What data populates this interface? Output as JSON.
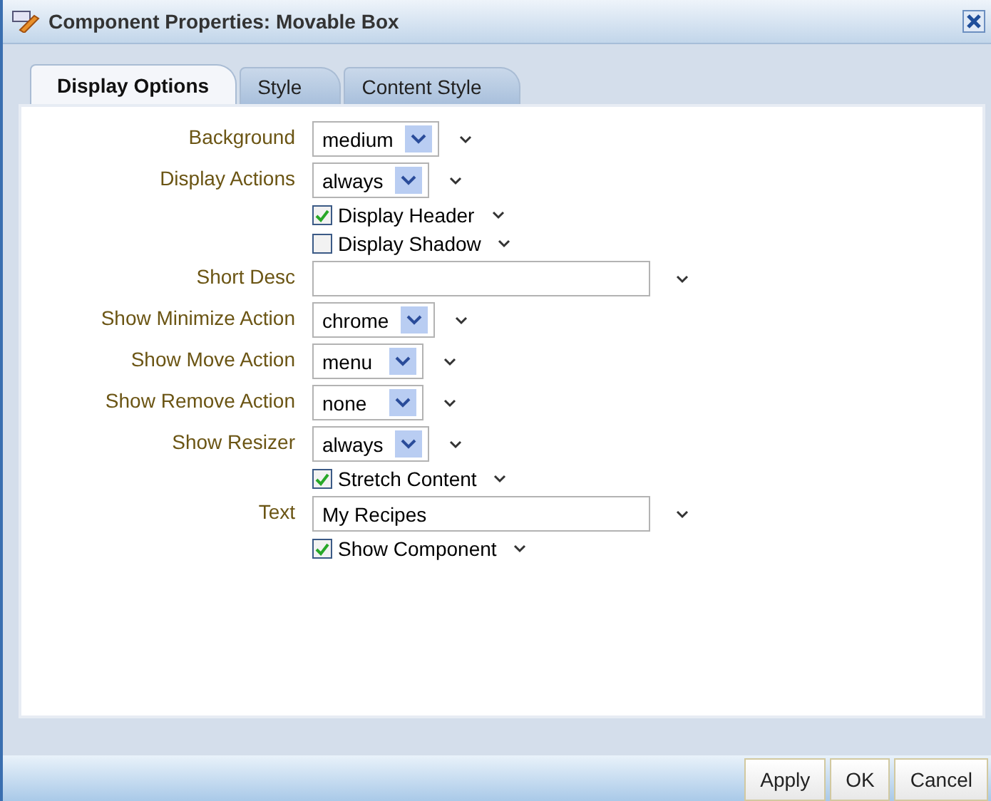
{
  "window": {
    "title": "Component Properties: Movable Box"
  },
  "tabs": [
    {
      "label": "Display Options",
      "selected": true
    },
    {
      "label": "Style",
      "selected": false
    },
    {
      "label": "Content Style",
      "selected": false
    }
  ],
  "fields": [
    {
      "kind": "select",
      "label": "Background",
      "value": "medium"
    },
    {
      "kind": "select",
      "label": "Display Actions",
      "value": "always"
    },
    {
      "kind": "checkbox",
      "label": "Display Header",
      "checked": true
    },
    {
      "kind": "checkbox",
      "label": "Display Shadow",
      "checked": false
    },
    {
      "kind": "text",
      "label": "Short Desc"
    },
    {
      "kind": "select",
      "label": "Show Minimize Action",
      "value": "chrome"
    },
    {
      "kind": "select",
      "label": "Show Move Action",
      "value": "menu"
    },
    {
      "kind": "select",
      "label": "Show Remove Action",
      "value": "none"
    },
    {
      "kind": "select",
      "label": "Show Resizer",
      "value": "always"
    },
    {
      "kind": "checkbox",
      "label": "Stretch Content",
      "checked": true
    },
    {
      "kind": "text",
      "label": "Text",
      "value": "My Recipes"
    },
    {
      "kind": "checkbox",
      "label": "Show Component",
      "checked": true
    }
  ],
  "buttons": [
    "Apply",
    "OK",
    "Cancel"
  ]
}
